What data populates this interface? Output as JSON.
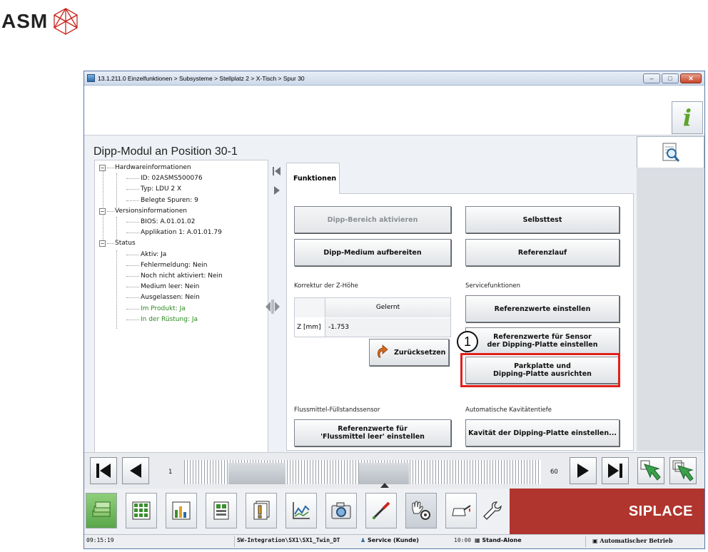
{
  "brand": {
    "name": "ASM"
  },
  "window": {
    "title": "13.1.211.0 Einzelfunktionen > Subsysteme > Stellplatz 2 > X-Tisch > Spur 30"
  },
  "info_label": "i",
  "page_title": "Dipp-Modul an Position 30-1",
  "tree": {
    "groups": [
      {
        "label": "Hardwareinformationen",
        "items": [
          {
            "label": "ID: 02ASMS500076",
            "green": false
          },
          {
            "label": "Typ: LDU 2 X",
            "green": false
          },
          {
            "label": "Belegte Spuren: 9",
            "green": false
          }
        ]
      },
      {
        "label": "Versionsinformationen",
        "items": [
          {
            "label": "BIOS: A.01.01.02",
            "green": false
          },
          {
            "label": "Applikation 1: A.01.01.79",
            "green": false
          }
        ]
      },
      {
        "label": "Status",
        "items": [
          {
            "label": "Aktiv: Ja",
            "green": false
          },
          {
            "label": "Fehlermeldung: Nein",
            "green": false
          },
          {
            "label": "Noch nicht aktiviert: Nein",
            "green": false
          },
          {
            "label": "Medium leer: Nein",
            "green": false
          },
          {
            "label": "Ausgelassen: Nein",
            "green": false
          },
          {
            "label": "Im Produkt: Ja",
            "green": true
          },
          {
            "label": "In der Rüstung: Ja",
            "green": true
          }
        ]
      }
    ]
  },
  "tab": {
    "label": "Funktionen"
  },
  "buttons": {
    "dipp_aktivieren": "Dipp-Bereich aktivieren",
    "selbsttest": "Selbsttest",
    "medium_aufbereiten": "Dipp-Medium aufbereiten",
    "referenzlauf": "Referenzlauf",
    "referenzwerte_einstellen": "Referenzwerte einstellen",
    "sensor_line1": "Referenzwerte für Sensor",
    "sensor_line2": "der Dipping-Platte einstellen",
    "parkplatte_line1": "Parkplatte und",
    "parkplatte_line2": "Dipping-Platte ausrichten",
    "zuruecksetzen": "Zurücksetzen",
    "fluss_line1": "Referenzwerte für",
    "fluss_line2": "'Flussmittel leer' einstellen",
    "kavitaet": "Kavität der Dipping-Platte einstellen..."
  },
  "sections": {
    "korrektur": "Korrektur der Z-Höhe",
    "service": "Servicefunktionen",
    "fluss": "Flussmittel-Füllstandssensor",
    "kavitaet": "Automatische Kavitätentiefe"
  },
  "z_table": {
    "col_header": "Gelernt",
    "row_label": "Z [mm]",
    "value": "-1.753"
  },
  "callout": "1",
  "pager": {
    "first": "1",
    "last": "60"
  },
  "toolbar": {
    "brand": "SIPLACE"
  },
  "status": {
    "time": "09:15:19",
    "path": "SW-Integration\\SX1\\SX1_Twin_DT",
    "service": "Service (Kunde)",
    "clock": "10:00",
    "mode": "Stand-Alone",
    "operation": "Automatischer Betrieb"
  }
}
